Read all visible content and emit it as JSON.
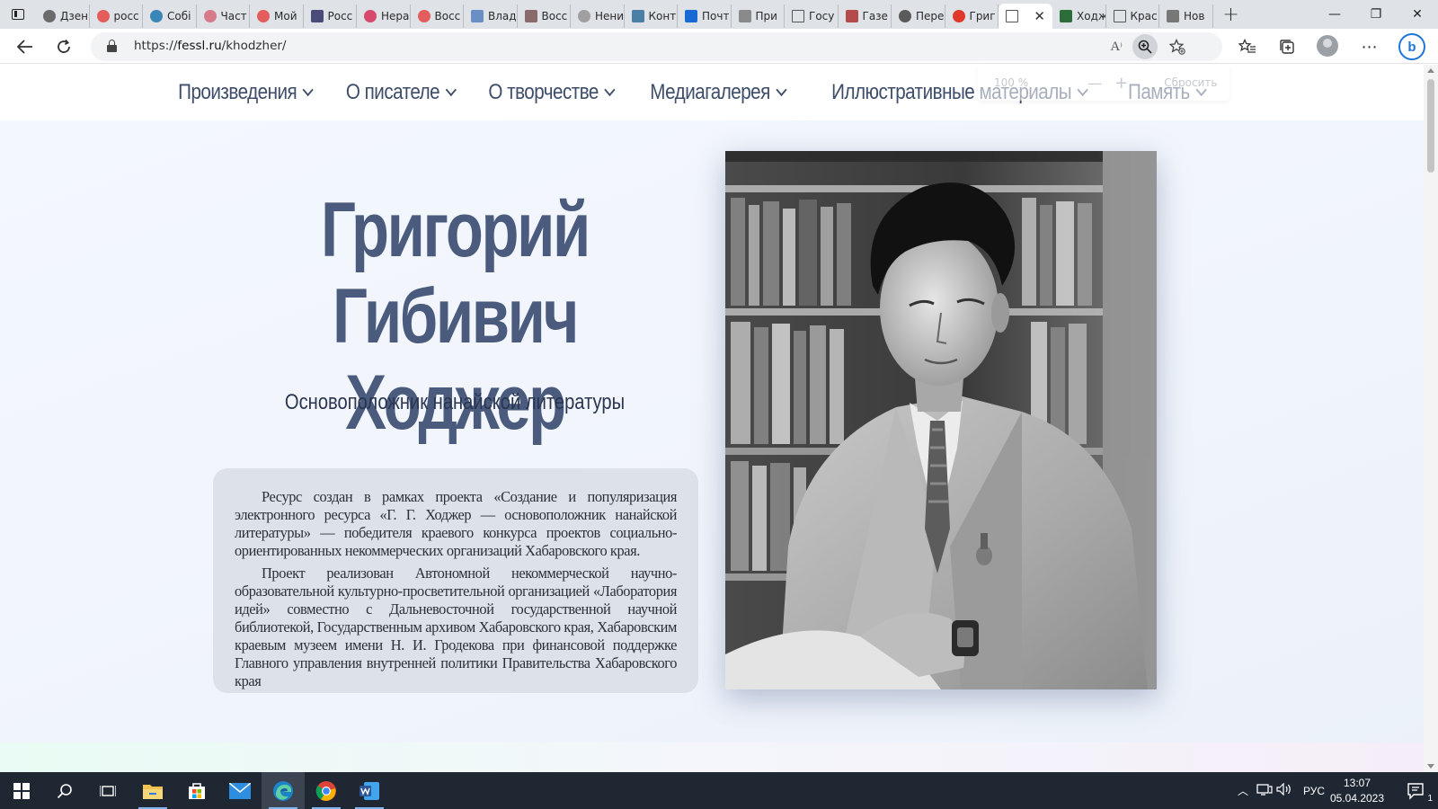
{
  "browser": {
    "tabs": [
      {
        "title": "Дзен",
        "color": "#6b6b6b",
        "shape": "circle"
      },
      {
        "title": "росс",
        "color": "#e35d5d",
        "shape": "circle"
      },
      {
        "title": "Собі",
        "color": "#3a86b6",
        "shape": "circle"
      },
      {
        "title": "Част",
        "color": "#d77b8a",
        "shape": "circle"
      },
      {
        "title": "Мой",
        "color": "#e35d5d",
        "shape": "circle"
      },
      {
        "title": "Росс",
        "color": "#4b4b7a",
        "shape": "square"
      },
      {
        "title": "Нера",
        "color": "#d84a6b",
        "shape": "circle"
      },
      {
        "title": "Восс",
        "color": "#e35d5d",
        "shape": "circle"
      },
      {
        "title": "Влад",
        "color": "#6a8fc4",
        "shape": "square"
      },
      {
        "title": "Восс",
        "color": "#8a6a6a",
        "shape": "square"
      },
      {
        "title": "Нени",
        "color": "#a0a0a0",
        "shape": "circle"
      },
      {
        "title": "Конт",
        "color": "#4a7fa6",
        "shape": "square"
      },
      {
        "title": "Почт",
        "color": "#1769d6",
        "shape": "square"
      },
      {
        "title": "При",
        "color": "#8a8a8a",
        "shape": "square"
      },
      {
        "title": "Госу",
        "color": "#555555",
        "shape": "doc"
      },
      {
        "title": "Газе",
        "color": "#b54a4a",
        "shape": "square"
      },
      {
        "title": "Пере",
        "color": "#5a5a5a",
        "shape": "circle"
      },
      {
        "title": "Григ",
        "color": "#e0382a",
        "shape": "circle"
      }
    ],
    "tabs_after_active": [
      {
        "title": "Ходж",
        "color": "#2b6e3a",
        "shape": "square"
      },
      {
        "title": "Крас",
        "color": "#555555",
        "shape": "doc"
      },
      {
        "title": "Нов",
        "color": "#777777",
        "shape": "square"
      }
    ],
    "active_tab": {
      "title": "",
      "close": "✕"
    },
    "newtab": "+",
    "window_controls": {
      "minimize": "—",
      "maximize": "❐",
      "close": "✕"
    },
    "url_host": "fessl.ru",
    "url_prefix": "https://",
    "url_path": "/khodzher/",
    "zoom_popup": {
      "value": "100 %",
      "minus": "—",
      "plus": "+",
      "reset": "Сбросить"
    }
  },
  "site": {
    "nav": [
      {
        "label": "Произведения"
      },
      {
        "label": "О писателе"
      },
      {
        "label": "О творчестве"
      },
      {
        "label": "Медиагалерея"
      },
      {
        "label": "Иллюстративные материалы"
      },
      {
        "label": "Память"
      }
    ],
    "title_line1": "Григорий Гибивич",
    "title_line2": "Ходжер",
    "subtitle": "Основоположник нанайской литературы",
    "para1": "Ресурс создан в рамках проекта «Создание и популяризация электронного ресурса «Г. Г. Ходжер — основоположник нанайской литературы» — победителя краевого конкурса проектов социально-ориентированных некоммерческих организаций Хабаровского края.",
    "para2": "Проект реализован Автономной некоммерческой научно-образовательной культурно-просветительной организацией «Лаборатория идей» совместно с Дальневосточной государственной научной библиотекой, Государственным архивом Хабаровского края, Хабаровским краевым музеем имени Н. И. Гродекова при финансовой поддержке Главного управления внутренней политики Правительства Хабаровского края"
  },
  "taskbar": {
    "apps": [
      {
        "name": "file-explorer",
        "color": "#f2c14e"
      },
      {
        "name": "microsoft-store",
        "color": "#3c8ce7"
      },
      {
        "name": "mail",
        "color": "#2d8ee0"
      },
      {
        "name": "edge",
        "color": "#2fa8d8"
      },
      {
        "name": "chrome",
        "color": "#e8453c"
      },
      {
        "name": "word",
        "color": "#2b5797"
      }
    ],
    "lang": "РУС",
    "time": "13:07",
    "date": "05.04.2023",
    "notifications": "1"
  }
}
